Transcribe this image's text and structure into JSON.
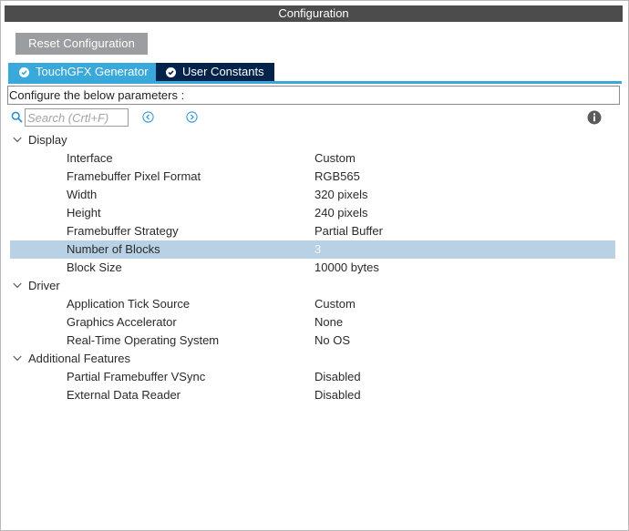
{
  "window": {
    "title": "Configuration"
  },
  "toolbar": {
    "reset_label": "Reset Configuration"
  },
  "tabs": [
    {
      "label": "TouchGFX Generator",
      "active": true,
      "icon": "check-circle-icon"
    },
    {
      "label": "User Constants",
      "active": false,
      "icon": "check-circle-icon"
    }
  ],
  "param_header": "Configure the below parameters :",
  "search": {
    "placeholder": "Search (Crtl+F)",
    "value": ""
  },
  "icons": {
    "search": "search-icon",
    "prev": "arrow-left-circle-icon",
    "next": "arrow-right-circle-icon",
    "info": "info-icon",
    "expand": "chevron-down-icon"
  },
  "colors": {
    "title_bar": "#4c4c4c",
    "reset_button": "#9a9ea1",
    "active_tab": "#39a9dc",
    "inactive_tab": "#03234b",
    "selected_row": "#b9d1e5"
  },
  "groups": [
    {
      "label": "Display",
      "expanded": true,
      "params": [
        {
          "name": "Interface",
          "value": "Custom"
        },
        {
          "name": "Framebuffer Pixel Format",
          "value": "RGB565"
        },
        {
          "name": "Width",
          "value": "320 pixels"
        },
        {
          "name": "Height",
          "value": "240 pixels"
        },
        {
          "name": "Framebuffer Strategy",
          "value": "Partial Buffer"
        },
        {
          "name": "Number of Blocks",
          "value": "3",
          "selected": true
        },
        {
          "name": "Block Size",
          "value": "10000 bytes"
        }
      ]
    },
    {
      "label": "Driver",
      "expanded": true,
      "params": [
        {
          "name": "Application Tick Source",
          "value": "Custom"
        },
        {
          "name": "Graphics Accelerator",
          "value": "None"
        },
        {
          "name": "Real-Time Operating System",
          "value": "No OS"
        }
      ]
    },
    {
      "label": "Additional Features",
      "expanded": true,
      "params": [
        {
          "name": "Partial Framebuffer VSync",
          "value": "Disabled"
        },
        {
          "name": "External Data Reader",
          "value": "Disabled"
        }
      ]
    }
  ]
}
